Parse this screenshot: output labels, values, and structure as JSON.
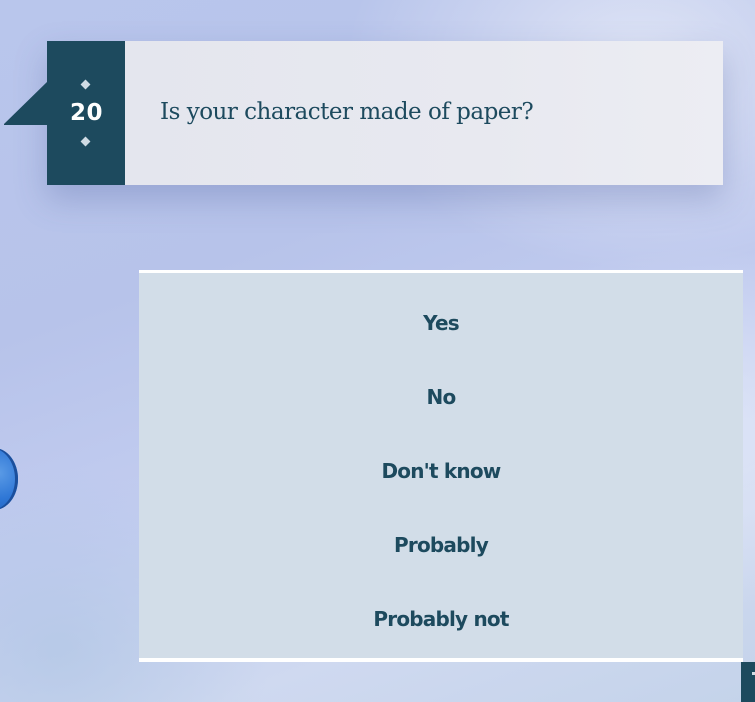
{
  "question": {
    "number": "20",
    "text": "Is your character made of paper?"
  },
  "answers": [
    "Yes",
    "No",
    "Don't know",
    "Probably",
    "Probably not"
  ],
  "colors": {
    "accent": "#1d4a5e",
    "panel": "#d2dde8",
    "card": "#e6e8ef",
    "background": "#bcc8ee"
  }
}
